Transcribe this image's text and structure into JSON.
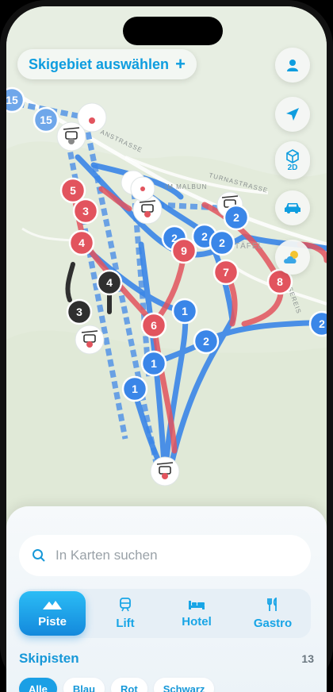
{
  "header": {
    "select_area_label": "Skigebiet auswählen",
    "plus": "+"
  },
  "controls": {
    "view_mode_label": "2D"
  },
  "map": {
    "street_labels": [
      "ANSTRASSE",
      "IM MALBUN",
      "TURNASTRASSE",
      "TÄFEL",
      "SEREIS"
    ],
    "colors": {
      "blue": "#3a86e8",
      "red": "#e2545e",
      "black": "#2f2f2f",
      "light_blue": "#6fa7ea"
    },
    "slope_markers": [
      {
        "label": "15",
        "color": "light_blue"
      },
      {
        "label": "15",
        "color": "light_blue"
      },
      {
        "label": "5",
        "color": "red"
      },
      {
        "label": "3",
        "color": "red"
      },
      {
        "label": "4",
        "color": "red"
      },
      {
        "label": "4",
        "color": "black"
      },
      {
        "label": "3",
        "color": "black"
      },
      {
        "label": "2",
        "color": "blue"
      },
      {
        "label": "9",
        "color": "red"
      },
      {
        "label": "2",
        "color": "blue"
      },
      {
        "label": "2",
        "color": "blue"
      },
      {
        "label": "2",
        "color": "blue"
      },
      {
        "label": "7",
        "color": "red"
      },
      {
        "label": "8",
        "color": "red"
      },
      {
        "label": "1",
        "color": "blue"
      },
      {
        "label": "6",
        "color": "red"
      },
      {
        "label": "2",
        "color": "blue"
      },
      {
        "label": "1",
        "color": "blue"
      },
      {
        "label": "1",
        "color": "blue"
      },
      {
        "label": "2",
        "color": "blue"
      }
    ]
  },
  "sheet": {
    "search_placeholder": "In Karten suchen",
    "categories": [
      {
        "label": "Piste",
        "icon": "mountain-icon",
        "active": true
      },
      {
        "label": "Lift",
        "icon": "train-icon",
        "active": false
      },
      {
        "label": "Hotel",
        "icon": "bed-icon",
        "active": false
      },
      {
        "label": "Gastro",
        "icon": "cutlery-icon",
        "active": false
      }
    ],
    "section_title": "Skipisten",
    "section_count": "13",
    "filters": [
      "Alle",
      "Blau",
      "Rot",
      "Schwarz"
    ]
  }
}
